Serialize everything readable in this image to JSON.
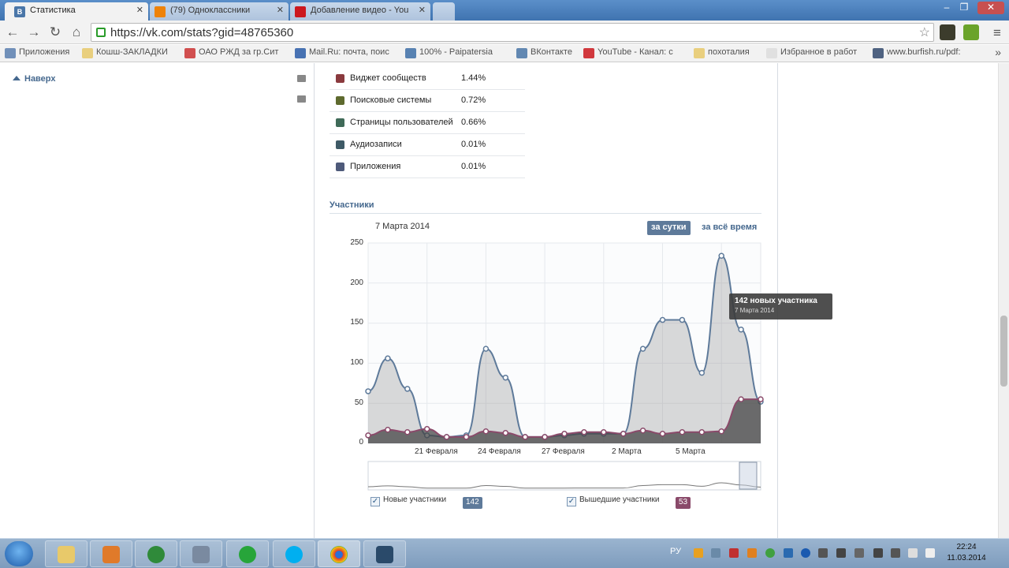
{
  "tabs": [
    {
      "title": "Статистика",
      "favicon": "В",
      "fav_color": "#4a76a8"
    },
    {
      "title": "(79) Одноклассники",
      "favicon": "ok",
      "fav_color": "#ee8208"
    },
    {
      "title": "Добавление видео - You",
      "favicon": "yt",
      "fav_color": "#cc181e"
    }
  ],
  "tab_close": "✕",
  "url": "https://vk.com/stats?gid=48765360",
  "bookmarks": [
    {
      "label": "Приложения",
      "color": "#5b7fb0"
    },
    {
      "label": "Кошш-ЗАКЛАДКИ",
      "color": "#e8c96a"
    },
    {
      "label": "ОАО РЖД за гр.Сит",
      "color": "#cc3333"
    },
    {
      "label": "Mail.Ru: почта, поис",
      "color": "#2a5ca8"
    },
    {
      "label": "100% - Paipatersia",
      "color": "#3e6fa8"
    },
    {
      "label": "ВКонтакте",
      "color": "#4a76a8"
    },
    {
      "label": "YouTube - Канал: с",
      "color": "#cc181e"
    },
    {
      "label": "похоталия",
      "color": "#e8c96a"
    },
    {
      "label": "Избранное в работ",
      "color": "#dddddd"
    },
    {
      "label": "www.burfish.ru/pdf:",
      "color": "#334a6e"
    }
  ],
  "sidebar": {
    "back_to_top": "Наверх"
  },
  "sources": [
    {
      "name": "Виджет сообществ",
      "percent": "1.44%",
      "color": "#8a3a3e"
    },
    {
      "name": "Поисковые системы",
      "percent": "0.72%",
      "color": "#5e6a2e"
    },
    {
      "name": "Страницы пользователей",
      "percent": "0.66%",
      "color": "#3f6a58"
    },
    {
      "name": "Аудиозаписи",
      "percent": "0.01%",
      "color": "#3e5a66"
    },
    {
      "name": "Приложения",
      "percent": "0.01%",
      "color": "#4e5a7a"
    }
  ],
  "members": {
    "title": "Участники",
    "date": "7 Марта 2014",
    "period_day": "за сутки",
    "period_all": "за всё время",
    "tooltip_line1": "142 новых участника",
    "tooltip_line2": "7 Марта 2014",
    "legend_new": "Новые участники",
    "legend_new_count": "142",
    "legend_left": "Вышедшие участники",
    "legend_left_count": "53",
    "new_color": "#5e7a9a",
    "left_color": "#8a4a6a"
  },
  "chart_data": {
    "type": "area",
    "title": "Участники",
    "ylim": [
      0,
      250
    ],
    "yticks": [
      0,
      50,
      100,
      150,
      200,
      250
    ],
    "xtick_labels": [
      "21 Февраля",
      "24 Февраля",
      "27 Февраля",
      "2 Марта",
      "5 Марта"
    ],
    "x": [
      "16 Февраля",
      "17 Февраля",
      "18 Февраля",
      "19 Февраля",
      "20 Февраля",
      "21 Февраля",
      "22 Февраля",
      "23 Февраля",
      "24 Февраля",
      "25 Февраля",
      "26 Февраля",
      "27 Февраля",
      "28 Февраля",
      "1 Марта",
      "2 Марта",
      "3 Марта",
      "4 Марта",
      "5 Марта",
      "6 Марта",
      "7 Марта",
      "8 Марта"
    ],
    "series": [
      {
        "name": "Новые участники",
        "values": [
          65,
          106,
          68,
          10,
          8,
          10,
          118,
          82,
          8,
          8,
          10,
          12,
          12,
          12,
          118,
          154,
          154,
          88,
          234,
          142,
          52
        ]
      },
      {
        "name": "Вышедшие участники",
        "values": [
          10,
          17,
          14,
          18,
          8,
          8,
          15,
          13,
          8,
          8,
          12,
          14,
          14,
          12,
          16,
          12,
          14,
          14,
          15,
          55,
          55
        ]
      }
    ]
  },
  "taskbar": {
    "language": "РУ",
    "time": "22:24",
    "date": "11.03.2014"
  }
}
